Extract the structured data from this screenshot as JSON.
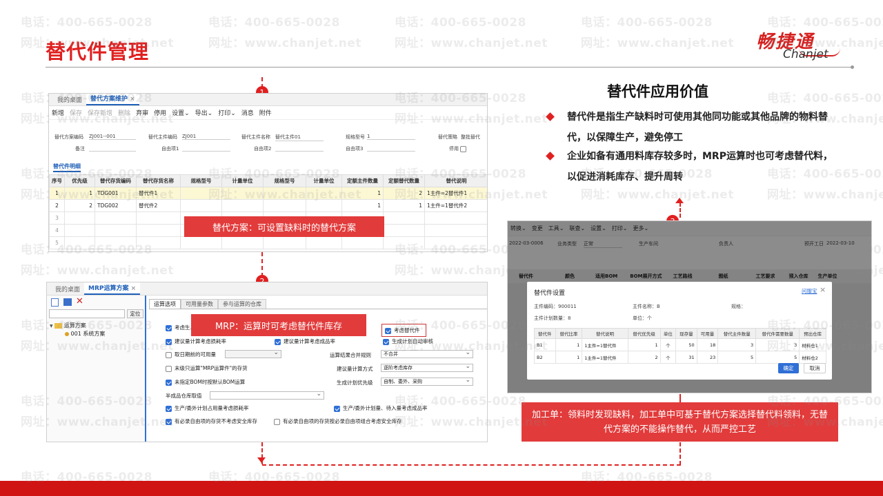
{
  "page": {
    "title": "替代件管理",
    "logo_cn": "畅捷通",
    "logo_en": "Chanjet"
  },
  "watermark": {
    "phone": "电话：400-665-0028",
    "site": "网址：www.chanjet.net"
  },
  "markers": [
    "1",
    "2",
    "3"
  ],
  "panel1": {
    "tabs": [
      "我的桌面",
      "替代方案维护"
    ],
    "close": "×",
    "toolbar": [
      "新增",
      "保存",
      "保存新增",
      "删除",
      "弃审",
      "停用",
      "设置⌄",
      "导出⌄",
      "打印⌄",
      "消息",
      "附件"
    ],
    "fields": {
      "code_label": "替代方案编码",
      "code": "ZJ001--001",
      "main_code_label": "替代主件编码",
      "main_code": "ZJ001",
      "main_name_label": "替代主件名称",
      "main_name": "替代主件01",
      "spec_label": "规格型号",
      "spec": "1",
      "strategy_label": "替代策略",
      "strategy": "整批替代",
      "note_label": "备注",
      "item1_label": "自由项1",
      "item2_label": "自由项2",
      "item3_label": "自由项3",
      "disable_label": "停用"
    },
    "detail_tab": "替代件明细",
    "headers": [
      "序号",
      "优先级",
      "替代存货编码",
      "替代存货名称",
      "规格型号",
      "计量单位",
      "规格型号",
      "计量单位",
      "定额主件数量",
      "定额替代数量",
      "替代说明"
    ],
    "rows": [
      [
        "1",
        "1",
        "TDG001",
        "替代件1",
        "",
        "",
        "",
        "",
        "1",
        "2",
        "1主件=2替代件1"
      ],
      [
        "2",
        "2",
        "TDG002",
        "替代件2",
        "",
        "",
        "",
        "",
        "1",
        "1",
        "1主件=1替代件2"
      ],
      [
        "3",
        "",
        "",
        "",
        "",
        "",
        "",
        "",
        "",
        "",
        ""
      ],
      [
        "4",
        "",
        "",
        "",
        "",
        "",
        "",
        "",
        "",
        "",
        ""
      ],
      [
        "5",
        "",
        "",
        "",
        "",
        "",
        "",
        "",
        "",
        "",
        ""
      ]
    ],
    "callout": "替代方案：可设置缺料时的替代方案"
  },
  "panel2": {
    "tabs": [
      "我的桌面",
      "MRP运算方案"
    ],
    "close": "×",
    "locate": "定位",
    "tree": [
      "运算方案",
      "001 系统方案"
    ],
    "option_tabs": [
      "运算选项",
      "可用量参数",
      "参与运算的仓库"
    ],
    "options": {
      "o1": "考虑生…",
      "o2": "建议量计算考虑损耗率",
      "o3": "建议量计算考虑成品率",
      "o4": "生成计划自动审核",
      "o5": "取日期前的可用量",
      "o6": "末级只运算\"MRP运算件\"的存货",
      "o7": "未指定BOM时按默认BOM运算",
      "o8": "生产/委外计划占用量考虑损耗率",
      "o9": "生产/委外计划量、待入量考虑成品率",
      "o10": "有必录自由项的存货不考虑安全库存",
      "o11": "有必录自由项的存货按必录自由项组合考虑安全库存",
      "o12": "考虑替代件"
    },
    "labels": {
      "merge": "运算结果合并规则",
      "calc": "建议量计算方式",
      "priority": "生成计划优先级",
      "semi": "半成品仓库取值"
    },
    "values": {
      "merge": "不合并",
      "calc": "逐阶考虑库存",
      "priority": "自制、委外、采购",
      "date": "",
      "semi": ""
    },
    "callout": "MRP：运算时可考虑替代件库存"
  },
  "value": {
    "title": "替代件应用价值",
    "points": [
      "替代件是指生产缺料时可使用其他同功能或其他品牌的物料替代，以保障生产，避免停工",
      "企业如备有通用料库存较多时，MRP运算时也可考虑替代料，以促进消耗库存、提升周转"
    ]
  },
  "panel3": {
    "toolbar": [
      "转换⌄",
      "变更",
      "工具⌄",
      "联查⌄",
      "设置⌄",
      "打印⌄",
      "更多⌄"
    ],
    "bg_fields": {
      "date": "2022-03-0006",
      "biz_type_label": "业务类型",
      "biz_type": "正常",
      "dept_label": "生产车间",
      "owner_label": "负责人",
      "start_label": "预开工日",
      "start": "2022-03-10"
    },
    "bg_headers": [
      "替代件",
      "颜色",
      "适用BOM",
      "BOM展开方式",
      "工艺路线",
      "图纸",
      "工艺要求",
      "预入仓库",
      "生产单位"
    ],
    "dialog": {
      "title": "替代件设置",
      "link": "问服宝",
      "close": "×",
      "main_code_label": "主件编码：",
      "main_code": "900011",
      "main_name_label": "主件名称：",
      "main_name": "B",
      "spec_label": "规格：",
      "spec": "",
      "plan_qty_label": "主件计划数量：",
      "plan_qty": "8",
      "unit_label": "单位：",
      "unit": "个",
      "headers": [
        "替代件",
        "替代比率",
        "替代说明",
        "替代优先级",
        "单位",
        "现存量",
        "可用量",
        "替代主件数量",
        "替代件需要数量",
        "预出仓库"
      ],
      "rows": [
        [
          "B1",
          "1",
          "1主件=1替代件",
          "1",
          "个",
          "50",
          "18",
          "3",
          "3",
          "材料仓1"
        ],
        [
          "B2",
          "1",
          "1主件=1替代件",
          "2",
          "个",
          "31",
          "23",
          "5",
          "5",
          "材料仓2"
        ]
      ],
      "ok": "确定",
      "cancel": "取消"
    },
    "callout": "加工单：领料时发现缺料，加工单中可基于替代方案选择替代料领料，无替代方案的不能操作替代，从而严控工艺"
  }
}
